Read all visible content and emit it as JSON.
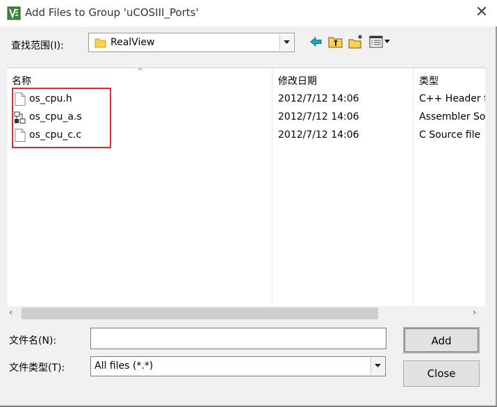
{
  "window": {
    "title": "Add Files to Group 'uCOSIII_Ports'",
    "close_glyph": "✕"
  },
  "look_in": {
    "label": "查找范围(I):",
    "value": "RealView"
  },
  "toolbar_icons": [
    "back-arrow-icon",
    "up-folder-icon",
    "new-folder-icon",
    "view-menu-icon"
  ],
  "columns": {
    "name": "名称",
    "modified": "修改日期",
    "type": "类型",
    "sort_indicator": "^"
  },
  "files": [
    {
      "name": "os_cpu.h",
      "modified": "2012/7/12 14:06",
      "type": "C++ Header f",
      "icon": "document-icon"
    },
    {
      "name": "os_cpu_a.s",
      "modified": "2012/7/12 14:06",
      "type": "Assembler Sou",
      "icon": "assembler-file-icon"
    },
    {
      "name": "os_cpu_c.c",
      "modified": "2012/7/12 14:06",
      "type": "C Source file",
      "icon": "document-icon"
    }
  ],
  "scrollbar": {
    "left_arrow": "‹",
    "right_arrow": "›"
  },
  "filename": {
    "label": "文件名(N):",
    "value": ""
  },
  "filetype": {
    "label": "文件类型(T):",
    "value": "All files (*.*)"
  },
  "buttons": {
    "add": "Add",
    "close": "Close"
  },
  "colors": {
    "highlight_border": "#e02a35",
    "dialog_bg": "#f0f0f0"
  }
}
